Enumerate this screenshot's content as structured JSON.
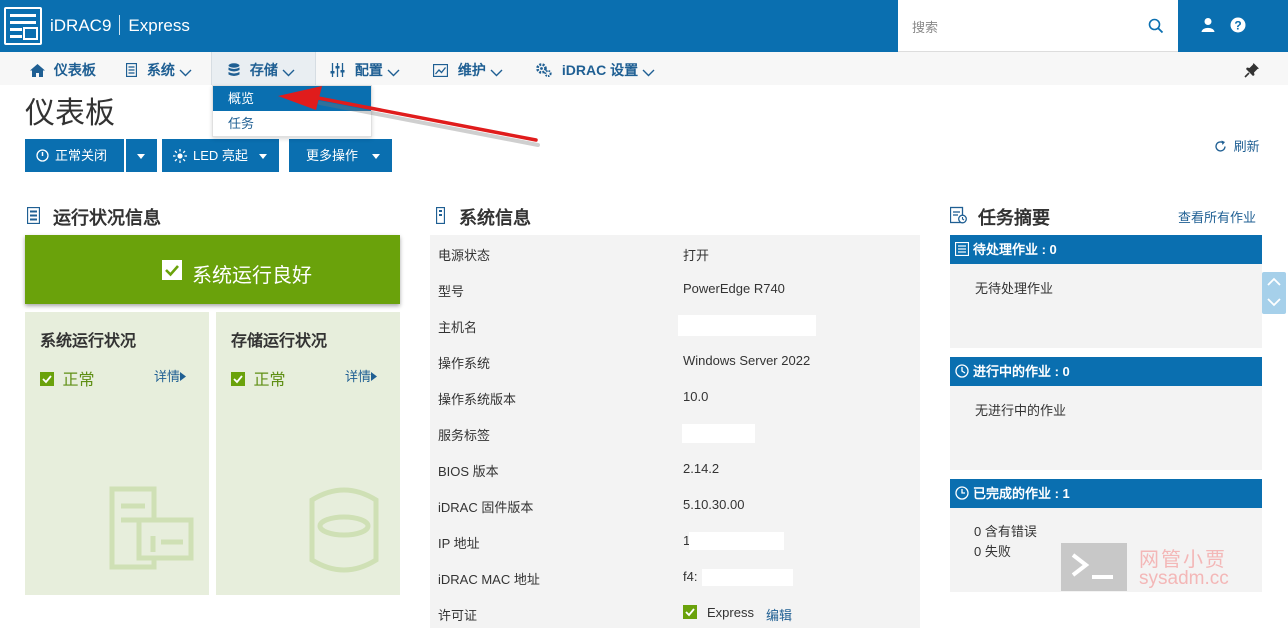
{
  "app": {
    "name": "iDRAC9",
    "edition": "Express"
  },
  "search": {
    "placeholder": "搜索"
  },
  "nav": {
    "dashboard": "仪表板",
    "system": "系统",
    "storage": "存储",
    "config": "配置",
    "maintenance": "维护",
    "idrac_settings": "iDRAC 设置"
  },
  "storage_menu": {
    "overview": "概览",
    "tasks": "任务"
  },
  "page": {
    "title": "仪表板"
  },
  "actions": {
    "shutdown": "正常关闭",
    "led": "LED 亮起",
    "more": "更多操作",
    "refresh": "刷新"
  },
  "health": {
    "title": "运行状况信息",
    "banner": "系统运行良好",
    "cards": [
      {
        "title": "系统运行状况",
        "status": "正常",
        "details": "详情"
      },
      {
        "title": "存储运行状况",
        "status": "正常",
        "details": "详情"
      }
    ]
  },
  "sysinfo": {
    "title": "系统信息",
    "rows": [
      {
        "key": "电源状态",
        "value": "打开"
      },
      {
        "key": "型号",
        "value": "PowerEdge R740"
      },
      {
        "key": "主机名",
        "value": ""
      },
      {
        "key": "操作系统",
        "value": "Windows Server 2022"
      },
      {
        "key": "操作系统版本",
        "value": "10.0"
      },
      {
        "key": "服务标签",
        "value": ""
      },
      {
        "key": "BIOS 版本",
        "value": "2.14.2"
      },
      {
        "key": "iDRAC 固件版本",
        "value": "5.10.30.00"
      },
      {
        "key": "IP 地址",
        "value": "1"
      },
      {
        "key": "iDRAC MAC 地址",
        "value": "f4:"
      },
      {
        "key": "许可证",
        "value": "Express",
        "link": "编辑"
      }
    ]
  },
  "tasks": {
    "title": "任务摘要",
    "view_all": "查看所有作业",
    "pending": {
      "header": "待处理作业 : 0",
      "body": "无待处理作业"
    },
    "running": {
      "header": "进行中的作业 : 0",
      "body": "无进行中的作业"
    },
    "completed": {
      "header": "已完成的作业 : 1",
      "errors": "0  含有错误",
      "failed": "0  失败"
    }
  },
  "watermark": {
    "line1": "网管小贾",
    "line2": "sysadm.cc"
  },
  "colors": {
    "brand_blue": "#0a6fb0",
    "health_green": "#6aa20b",
    "link_blue": "#1f5f93"
  }
}
